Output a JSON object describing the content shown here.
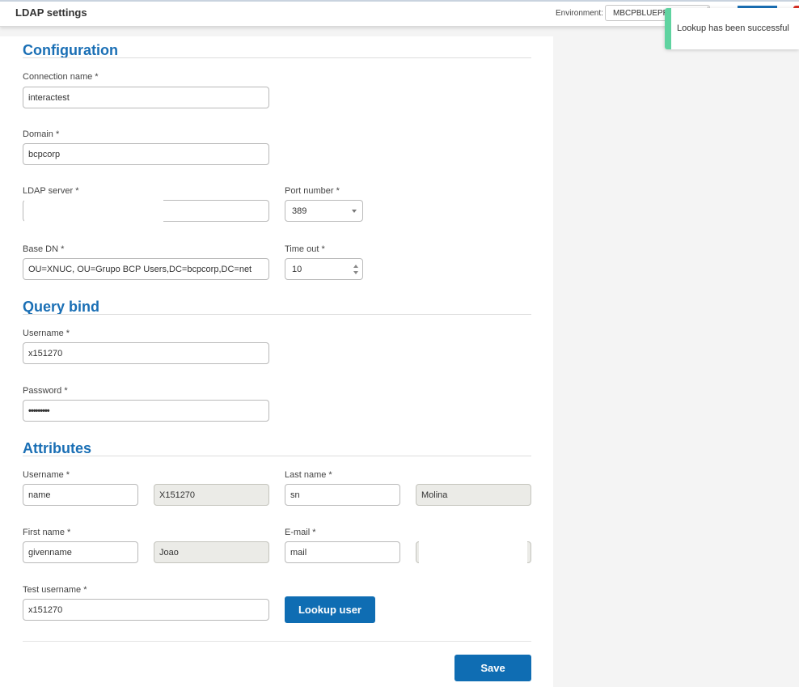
{
  "header": {
    "title": "LDAP settings",
    "environment_label": "Environment:",
    "environment_value": "MBCPBLUEPRI"
  },
  "toast": {
    "message": "Lookup has been successful",
    "color": "#5fd3a0"
  },
  "configuration": {
    "title": "Configuration",
    "connection_name": {
      "label": "Connection name *",
      "value": "interactest"
    },
    "domain": {
      "label": "Domain *",
      "value": "bcpcorp"
    },
    "ldap_server": {
      "label": "LDAP server *",
      "value": ""
    },
    "port_number": {
      "label": "Port number *",
      "value": "389"
    },
    "base_dn": {
      "label": "Base DN *",
      "value": "OU=XNUC, OU=Grupo BCP Users,DC=bcpcorp,DC=net"
    },
    "time_out": {
      "label": "Time out *",
      "value": "10"
    }
  },
  "query_bind": {
    "title": "Query bind",
    "username": {
      "label": "Username *",
      "value": "x151270"
    },
    "password": {
      "label": "Password *",
      "value": "•••••••••"
    }
  },
  "attributes": {
    "title": "Attributes",
    "username": {
      "label": "Username *",
      "value": "name",
      "result": "X151270"
    },
    "last_name": {
      "label": "Last name *",
      "value": "sn",
      "result": "Molina"
    },
    "first_name": {
      "label": "First name *",
      "value": "givenname",
      "result": "Joao"
    },
    "email": {
      "label": "E-mail *",
      "value": "mail",
      "result": ""
    },
    "test_username": {
      "label": "Test username *",
      "value": "x151270"
    },
    "lookup_button": "Lookup user"
  },
  "save_button": "Save",
  "colors": {
    "accent": "#1a6fb5",
    "button": "#0f6db3",
    "readonly_bg": "#ebebe7"
  }
}
